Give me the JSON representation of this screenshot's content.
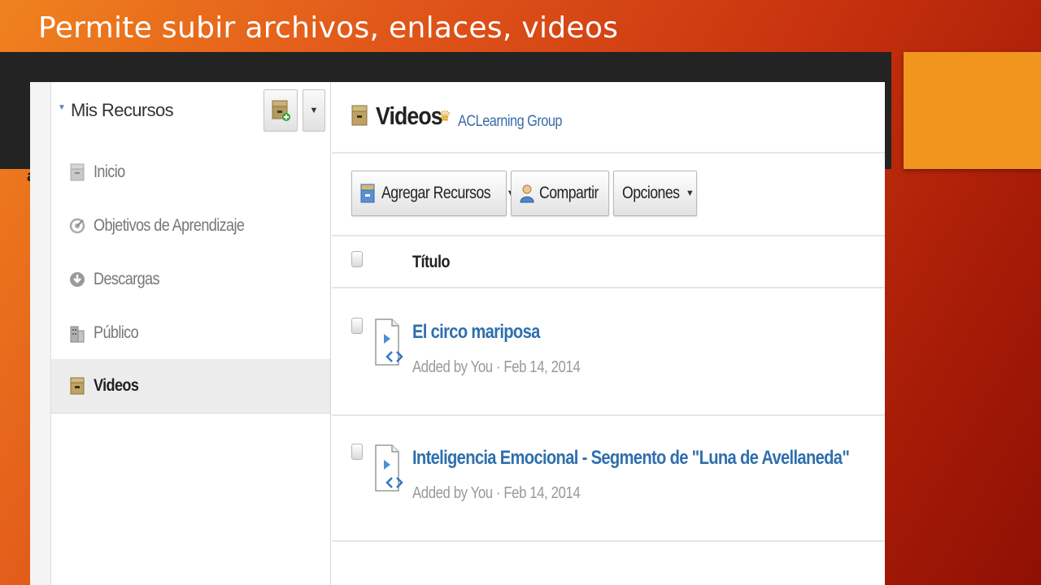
{
  "slide": {
    "title": "Permite subir archivos, enlaces, videos",
    "cut_text": "al"
  },
  "sidebar": {
    "title": "Mis Recursos",
    "items": [
      {
        "label": "Inicio",
        "icon": "cabinet-icon",
        "active": false
      },
      {
        "label": "Objetivos de Aprendizaje",
        "icon": "target-icon",
        "active": false
      },
      {
        "label": "Descargas",
        "icon": "download-icon",
        "active": false
      },
      {
        "label": "Público",
        "icon": "building-icon",
        "active": false
      },
      {
        "label": "Videos",
        "icon": "cabinet-icon",
        "active": true
      }
    ]
  },
  "main": {
    "title": "Videos",
    "group": "ACLearning Group",
    "toolbar": {
      "add_resources": "Agregar Recursos",
      "share": "Compartir",
      "options": "Opciones"
    },
    "columns": {
      "title": "Título"
    },
    "items": [
      {
        "title": "El circo mariposa",
        "meta": "Added by You · Feb 14, 2014"
      },
      {
        "title": "Inteligencia Emocional - Segmento de \"Luna de Avellaneda\"",
        "meta": "Added by You · Feb 14, 2014"
      }
    ]
  },
  "colors": {
    "accent_orange": "#f0951e",
    "dark_band": "#232323",
    "link_blue": "#2f6fae",
    "group_blue": "#3a6da8"
  }
}
